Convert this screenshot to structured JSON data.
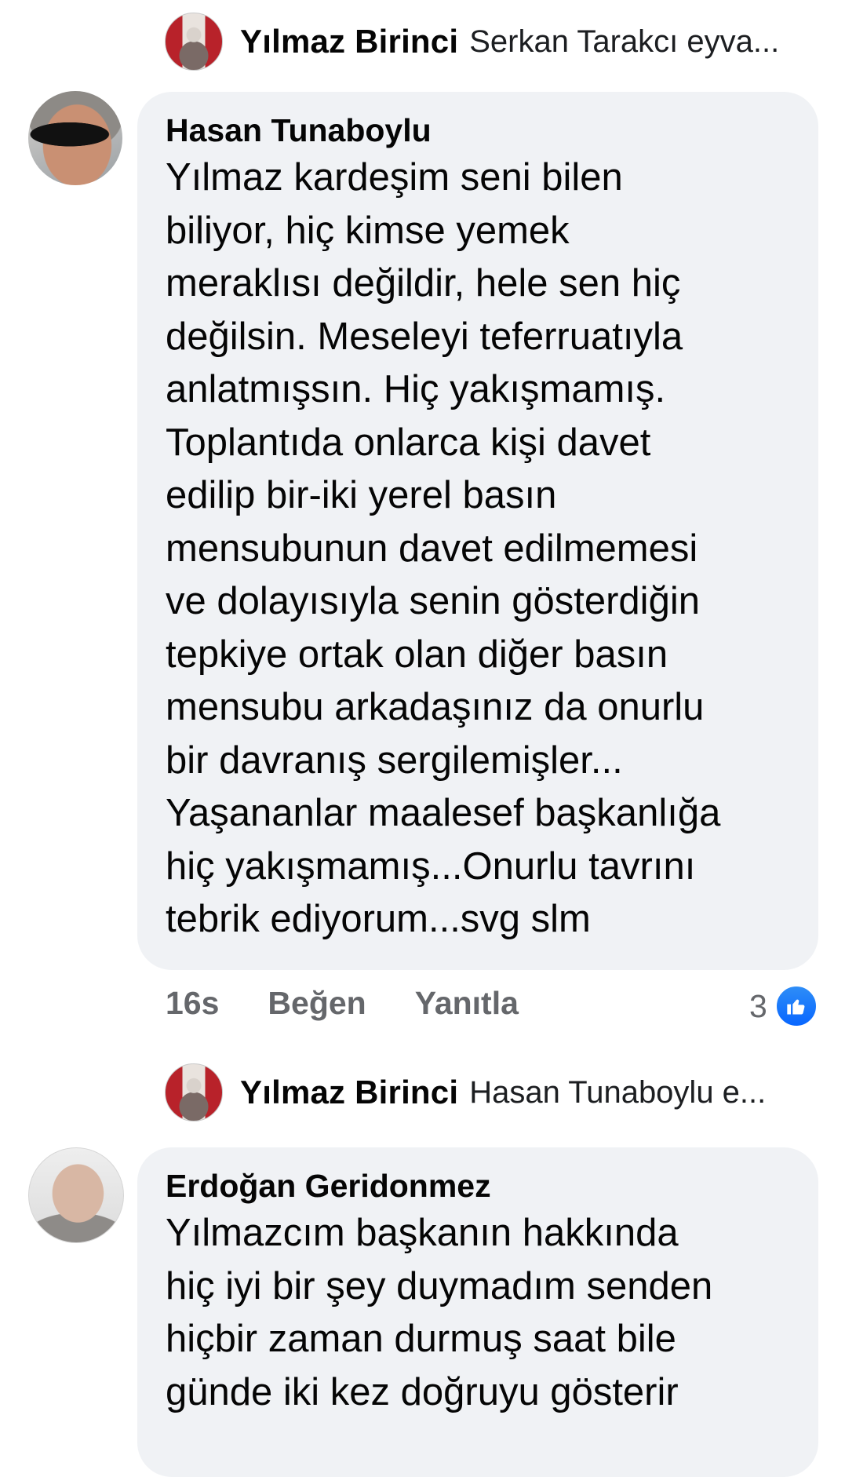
{
  "replies": [
    {
      "name": "Yılmaz Birinci",
      "snippet": "Serkan Tarakcı eyva..."
    },
    {
      "name": "Yılmaz Birinci",
      "snippet": "Hasan Tunaboylu e..."
    }
  ],
  "comments": [
    {
      "author": "Hasan Tunaboylu",
      "lines": [
        "Yılmaz kardeşim seni bilen",
        "biliyor, hiç kimse yemek",
        "meraklısı değildir, hele sen hiç",
        "değilsin. Meseleyi teferruatıyla",
        "anlatmışsın. Hiç yakışmamış.",
        "Toplantıda onlarca kişi davet",
        "edilip bir-iki yerel basın",
        "mensubunun davet edilmemesi",
        "ve dolayısıyla senin gösterdiğin",
        "tepkiye ortak olan diğer basın",
        "mensubu arkadaşınız da onurlu",
        "bir davranış sergilemişler...",
        "Yaşananlar maalesef başkanlığa",
        "hiç yakışmamış...Onurlu tavrını",
        "tebrik ediyorum...svg slm"
      ],
      "time": "16s",
      "like_label": "Beğen",
      "reply_label": "Yanıtla",
      "reaction_count": "3"
    },
    {
      "author": "Erdoğan Geridonmez",
      "lines": [
        "Yılmazcım başkanın hakkında",
        "hiç iyi bir şey duymadım senden",
        "hiçbir zaman durmuş saat bile",
        "günde iki kez doğruyu gösterir"
      ]
    }
  ],
  "icons": {
    "reaction": "like-icon"
  },
  "colors": {
    "bubble": "#f0f2f5",
    "like": "#0866ff",
    "meta": "#65676b"
  }
}
